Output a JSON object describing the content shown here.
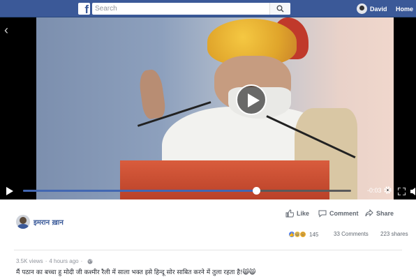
{
  "topbar": {
    "search_placeholder": "Search",
    "profile_name": "David",
    "home_label": "Home",
    "brand_color": "#3b5998"
  },
  "video": {
    "time_remaining": "-0:03",
    "progress": 0.71,
    "icons": [
      "back-arrow-icon",
      "play-icon",
      "gear-icon",
      "fullscreen-icon",
      "volume-icon"
    ]
  },
  "post": {
    "author": "इमरान ख़ान",
    "actions": {
      "like": "Like",
      "comment": "Comment",
      "share": "Share"
    },
    "reaction_count": "145",
    "comments": "33 Comments",
    "shares": "223 shares",
    "views": "3.5K views",
    "time_ago": "4 hours ago",
    "caption": "मैं पठान का बच्चा हु मोदी जी कश्मीर रैली में साला भक्त इसे हिन्दू सोर साबित करने में तुला रहता है!😸😸"
  }
}
